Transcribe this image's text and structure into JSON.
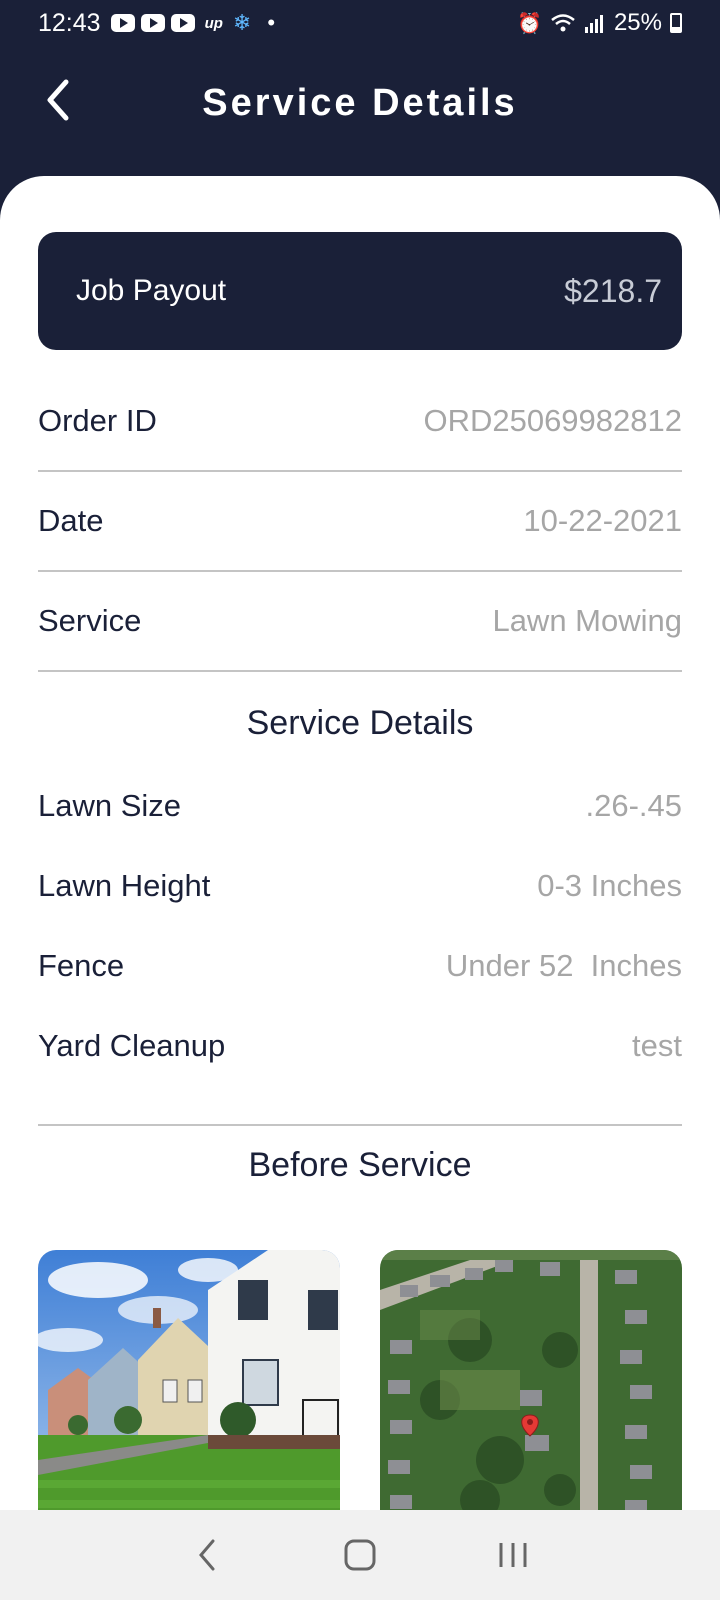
{
  "status_bar": {
    "time": "12:43",
    "notif_up": "up",
    "battery": "25%"
  },
  "header": {
    "title": "Service Details"
  },
  "payout": {
    "label": "Job Payout",
    "value": "$218.7"
  },
  "order": [
    {
      "label": "Order ID",
      "value": "ORD25069982812"
    },
    {
      "label": "Date",
      "value": "10-22-2021"
    },
    {
      "label": "Service",
      "value": "Lawn Mowing"
    }
  ],
  "service_details": {
    "title": "Service Details",
    "items": [
      {
        "label": "Lawn Size",
        "value": ".26-.45"
      },
      {
        "label": "Lawn Height",
        "value": "0-3 Inches"
      },
      {
        "label": "Fence",
        "value": "Under 52  Inches"
      },
      {
        "label": "Yard Cleanup",
        "value": "test"
      }
    ]
  },
  "before_service": {
    "title": "Before Service"
  },
  "icons": {
    "back": "chevron-left-icon",
    "nav_back": "nav-back-icon",
    "nav_home": "nav-home-icon",
    "nav_recents": "nav-recents-icon"
  }
}
